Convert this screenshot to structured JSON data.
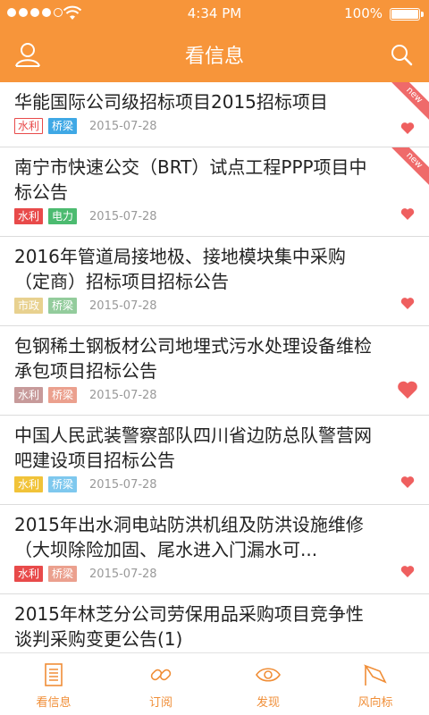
{
  "status": {
    "time": "4:34 PM",
    "battery": "100%"
  },
  "header": {
    "title": "看信息"
  },
  "list": [
    {
      "title": "华能国际公司级招标项目2015招标项目",
      "tags": [
        {
          "label": "水利",
          "style": "red"
        },
        {
          "label": "桥梁",
          "style": "blue-solid"
        }
      ],
      "date": "2015-07-28",
      "new": "new"
    },
    {
      "title": "南宁市快速公交（BRT）试点工程PPP项目中标公告",
      "tags": [
        {
          "label": "水利",
          "style": "red-solid"
        },
        {
          "label": "电力",
          "style": "green-solid"
        }
      ],
      "date": "2015-07-28",
      "new": "new"
    },
    {
      "title": "2016年管道局接地极、接地模块集中采购（定商）招标项目招标公告",
      "tags": [
        {
          "label": "市政",
          "style": "mute-yellow"
        },
        {
          "label": "桥梁",
          "style": "mute-green"
        }
      ],
      "date": "2015-07-28"
    },
    {
      "title": "包钢稀土钢板材公司地埋式污水处理设备维检承包项目招标公告",
      "tags": [
        {
          "label": "水利",
          "style": "brown"
        },
        {
          "label": "桥梁",
          "style": "salmon"
        }
      ],
      "date": "2015-07-28"
    },
    {
      "title": "中国人民武装警察部队四川省边防总队警营网吧建设项目招标公告",
      "tags": [
        {
          "label": "水利",
          "style": "yellow-solid"
        },
        {
          "label": "桥梁",
          "style": "lightblue-solid"
        }
      ],
      "date": "2015-07-28"
    },
    {
      "title": "2015年出水洞电站防洪机组及防洪设施维修（大坝除险加固、尾水进入门漏水可...",
      "tags": [
        {
          "label": "水利",
          "style": "red-solid"
        },
        {
          "label": "桥梁",
          "style": "salmon"
        }
      ],
      "date": "2015-07-28"
    },
    {
      "title": "2015年林芝分公司劳保用品采购项目竞争性谈判采购变更公告(1)",
      "tags": [],
      "date": ""
    }
  ],
  "tabs": [
    {
      "label": "看信息",
      "icon": "document-icon"
    },
    {
      "label": "订阅",
      "icon": "link-icon"
    },
    {
      "label": "发现",
      "icon": "eye-icon"
    },
    {
      "label": "风向标",
      "icon": "flag-icon"
    }
  ],
  "colors": {
    "accent": "#f7953a",
    "heart": "#ef5f5f"
  }
}
